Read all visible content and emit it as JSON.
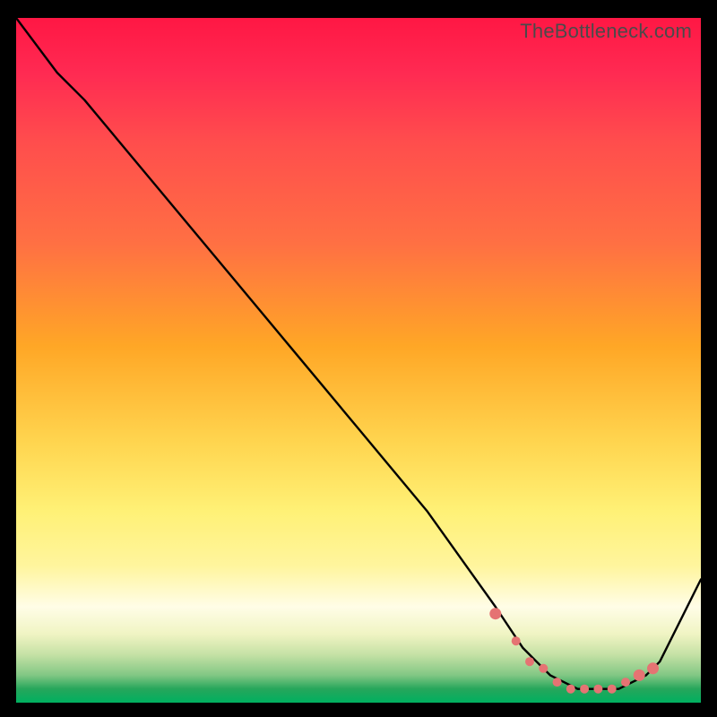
{
  "watermark": "TheBottleneck.com",
  "colors": {
    "curve": "#000000",
    "marker": "#e57373"
  },
  "chart_data": {
    "type": "line",
    "title": "",
    "xlabel": "",
    "ylabel": "",
    "xlim": [
      0,
      100
    ],
    "ylim": [
      0,
      100
    ],
    "grid": false,
    "series": [
      {
        "name": "bottleneck-curve",
        "x": [
          0,
          6,
          10,
          20,
          30,
          40,
          50,
          60,
          70,
          74,
          76,
          78,
          80,
          82,
          84,
          86,
          88,
          90,
          92,
          94,
          100
        ],
        "values": [
          100,
          92,
          88,
          76,
          64,
          52,
          40,
          28,
          14,
          8,
          6,
          4,
          3,
          2,
          2,
          2,
          2,
          3,
          4,
          6,
          18
        ]
      }
    ],
    "markers": {
      "name": "optimal-range",
      "x": [
        70,
        73,
        75,
        77,
        79,
        81,
        83,
        85,
        87,
        89,
        91,
        93
      ],
      "values": [
        13,
        9,
        6,
        5,
        3,
        2,
        2,
        2,
        2,
        3,
        4,
        5
      ]
    }
  }
}
